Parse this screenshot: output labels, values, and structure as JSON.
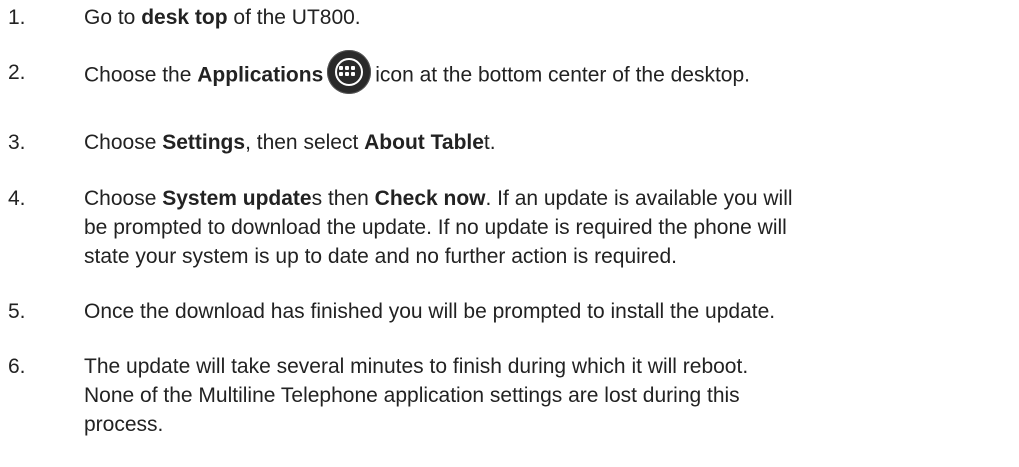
{
  "steps": [
    {
      "num": "1.",
      "parts": [
        "Go to ",
        "desk top",
        " of the UT800."
      ]
    },
    {
      "num": "2.",
      "parts": [
        "Choose the ",
        "Applications",
        "icon at the bottom center of the desktop."
      ],
      "icon": "applications-icon"
    },
    {
      "num": "3.",
      "parts": [
        "Choose ",
        "Settings",
        ", then select ",
        "About Table",
        "t."
      ]
    },
    {
      "num": "4.",
      "lines": [
        [
          "Choose ",
          "System update",
          "s then ",
          "Check now",
          ". If an update is available you will"
        ],
        "be prompted to download the update. If no update is required the phone will",
        "state your system is up to date and no further action is required."
      ]
    },
    {
      "num": "5.",
      "line": "Once the download has finished you will be prompted to install the update."
    },
    {
      "num": "6.",
      "lines": [
        "The update will take several minutes to finish during which it will reboot.",
        "None of the Multiline Telephone application settings are lost during this",
        "process."
      ]
    }
  ]
}
